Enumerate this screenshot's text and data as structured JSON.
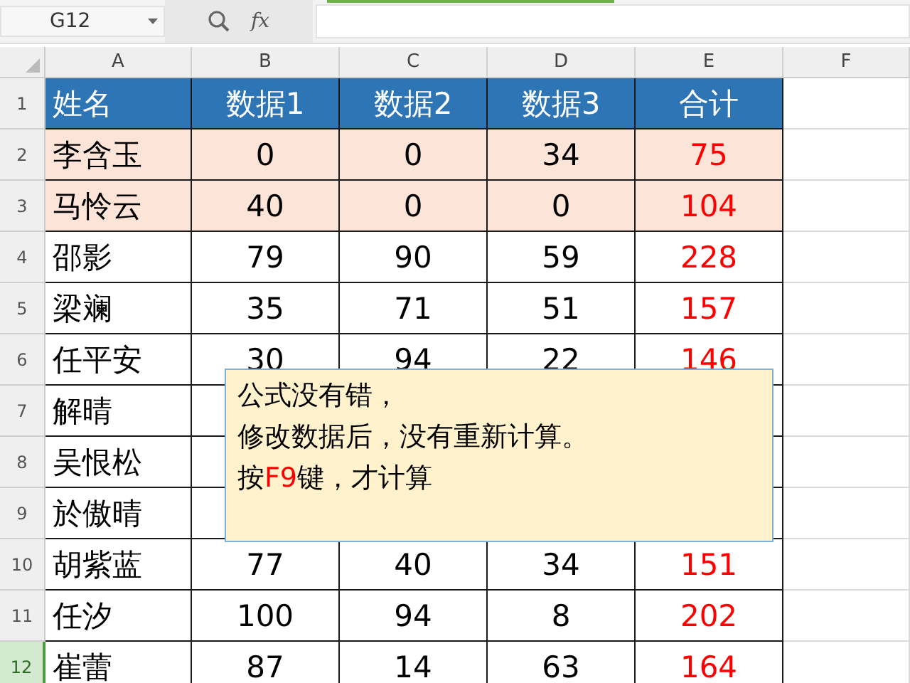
{
  "formula_bar": {
    "name_box": "G12",
    "function_label": "fx"
  },
  "columns": [
    "A",
    "B",
    "C",
    "D",
    "E",
    "F"
  ],
  "rows": [
    {
      "number": "1",
      "selected": false,
      "kind": "header",
      "cells": [
        "姓名",
        "数据1",
        "数据2",
        "数据3",
        "合计"
      ]
    },
    {
      "number": "2",
      "selected": false,
      "kind": "highlight",
      "cells": [
        "李含玉",
        "0",
        "0",
        "34",
        "75"
      ]
    },
    {
      "number": "3",
      "selected": false,
      "kind": "highlight",
      "cells": [
        "马怜云",
        "40",
        "0",
        "0",
        "104"
      ]
    },
    {
      "number": "4",
      "selected": false,
      "kind": "plain",
      "cells": [
        "邵影",
        "79",
        "90",
        "59",
        "228"
      ]
    },
    {
      "number": "5",
      "selected": false,
      "kind": "plain",
      "cells": [
        "梁斓",
        "35",
        "71",
        "51",
        "157"
      ]
    },
    {
      "number": "6",
      "selected": false,
      "kind": "plain",
      "cells": [
        "任平安",
        "30",
        "94",
        "22",
        "146"
      ]
    },
    {
      "number": "7",
      "selected": false,
      "kind": "plain",
      "cells": [
        "解晴"
      ]
    },
    {
      "number": "8",
      "selected": false,
      "kind": "plain",
      "cells": [
        "吴恨松"
      ]
    },
    {
      "number": "9",
      "selected": false,
      "kind": "plain",
      "cells": [
        "於傲晴"
      ]
    },
    {
      "number": "10",
      "selected": false,
      "kind": "plain",
      "cells": [
        "胡紫蓝",
        "77",
        "40",
        "34",
        "151"
      ]
    },
    {
      "number": "11",
      "selected": false,
      "kind": "plain",
      "cells": [
        "任汐",
        "100",
        "94",
        "8",
        "202"
      ]
    },
    {
      "number": "12",
      "selected": true,
      "kind": "plain",
      "cells": [
        "崔蕾",
        "87",
        "14",
        "63",
        "164"
      ]
    }
  ],
  "comment": {
    "lines": [
      [
        {
          "text": "公式没有错，",
          "highlight": false
        }
      ],
      [
        {
          "text": "修改数据后，没有重新计算。",
          "highlight": false
        }
      ],
      [
        {
          "text": "按",
          "highlight": false
        },
        {
          "text": "F9",
          "highlight": true
        },
        {
          "text": "键，才计算",
          "highlight": false
        }
      ]
    ]
  }
}
